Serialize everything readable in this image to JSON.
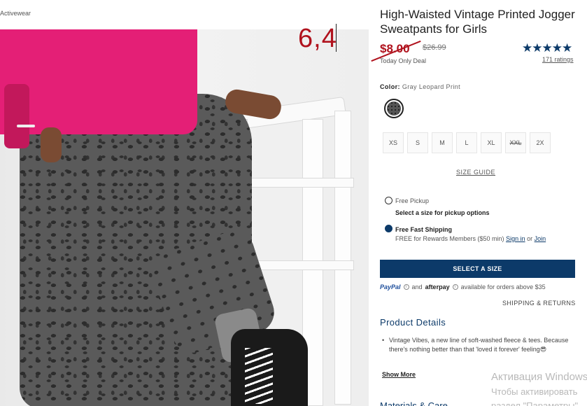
{
  "breadcrumb": "Activewear",
  "overlay_text": "6,4",
  "product": {
    "title": "High-Waisted Vintage Printed Jogger Sweatpants for Girls",
    "sale_price": "$8.00",
    "original_price": "$26.99",
    "deal_text": "Today Only Deal",
    "stars": "★★★★★",
    "ratings_text": "171 ratings",
    "color_label": "Color:",
    "color_value": "Gray Leopard Print"
  },
  "sizes": [
    {
      "label": "XS",
      "available": true
    },
    {
      "label": "S",
      "available": true
    },
    {
      "label": "M",
      "available": true
    },
    {
      "label": "L",
      "available": true
    },
    {
      "label": "XL",
      "available": true
    },
    {
      "label": "XXL",
      "available": false
    },
    {
      "label": "2X",
      "available": true
    }
  ],
  "size_guide": "SIZE GUIDE",
  "fulfillment": {
    "pickup_label": "Free Pickup",
    "pickup_note": "Select a size for pickup options",
    "shipping_label": "Free Fast Shipping",
    "shipping_note_prefix": "FREE for Rewards Members ($50 min)",
    "sign_in": "Sign in",
    "or": "or",
    "join": "Join"
  },
  "cta_label": "SELECT A SIZE",
  "payment": {
    "paypal": "PayPal",
    "and": "and",
    "afterpay": "afterpay",
    "suffix": "available for orders above $35",
    "info": "i"
  },
  "shipping_returns": "SHIPPING & RETURNS",
  "details": {
    "title": "Product Details",
    "bullet": "Vintage Vibes, a new line of soft-washed fleece & tees. Because there's nothing better than that 'loved it forever' feeling😎",
    "show_more": "Show More",
    "next_title": "Materials & Care"
  },
  "watermark": {
    "line1": "Активация Windows",
    "line2": "Чтобы активировать",
    "line3": "раздел \"Параметры\""
  },
  "colors": {
    "brand_navy": "#0c3a69",
    "sale_red": "#b0121d"
  }
}
